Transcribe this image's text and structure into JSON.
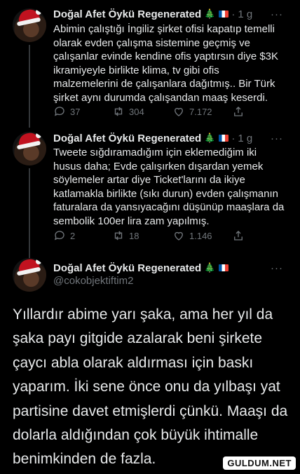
{
  "tweets": [
    {
      "author": "Doğal Afet Öykü Regenerated",
      "time": "1 g",
      "more": "···",
      "text": "Abimin çalıştığı İngiliz şirket ofisi kapatıp temelli\nolarak evden çalışma sistemine geçmiş ve\nçalışanlar evinde kendine ofis yaptırsın diye $3K\nikramiyeyle birlikte klima, tv gibi ofis\nmalzemelerini de çalışanlara dağıtmış.. Bir Türk\nşirket aynı durumda çalışandan maaş keserdi.",
      "replies": "37",
      "retweets": "304",
      "likes": "7.172"
    },
    {
      "author": "Doğal Afet Öykü Regenerated",
      "time": "1 g",
      "more": "···",
      "text": "Tweete sığdıramadığım için eklemediğim iki\nhusus daha; Evde çalışırken dışardan yemek\nsöylemeler artar diye Ticket'larını da ikiye\nkatlamakla birlikte (sıkı durun) evden çalışmanın\nfaturalara da yansıyacağını düşünüp maaşlara da\nsembolik 100er lira zam yapılmış.",
      "replies": "2",
      "retweets": "18",
      "likes": "1.146"
    }
  ],
  "main_tweet": {
    "author": "Doğal Afet Öykü Regenerated",
    "handle": "@cokobjektiftim2",
    "more": "···",
    "text": "Yıllardır abime yarı şaka, ama her yıl da\nşaka payı gitgide azalarak beni şirkete\nçaycı abla olarak aldırması için baskı\nyaparım. İki sene önce onu da yılbaşı yat\npartisine davet etmişlerdi çünkü. Maaşı da\ndolarla aldığından çok büyük ihtimalle\nbenimkinden de fazla."
  },
  "icons": {
    "reply": "reply-icon",
    "retweet": "retweet-icon",
    "like": "heart-icon",
    "share": "share-icon",
    "tree": "christmas-tree-emoji",
    "flag": "france-flag-emoji"
  },
  "watermark": "GULDUM.NET",
  "colors": {
    "background": "#000000",
    "text": "#e7e9ea",
    "muted": "#71767b",
    "divider": "#2f3336"
  }
}
